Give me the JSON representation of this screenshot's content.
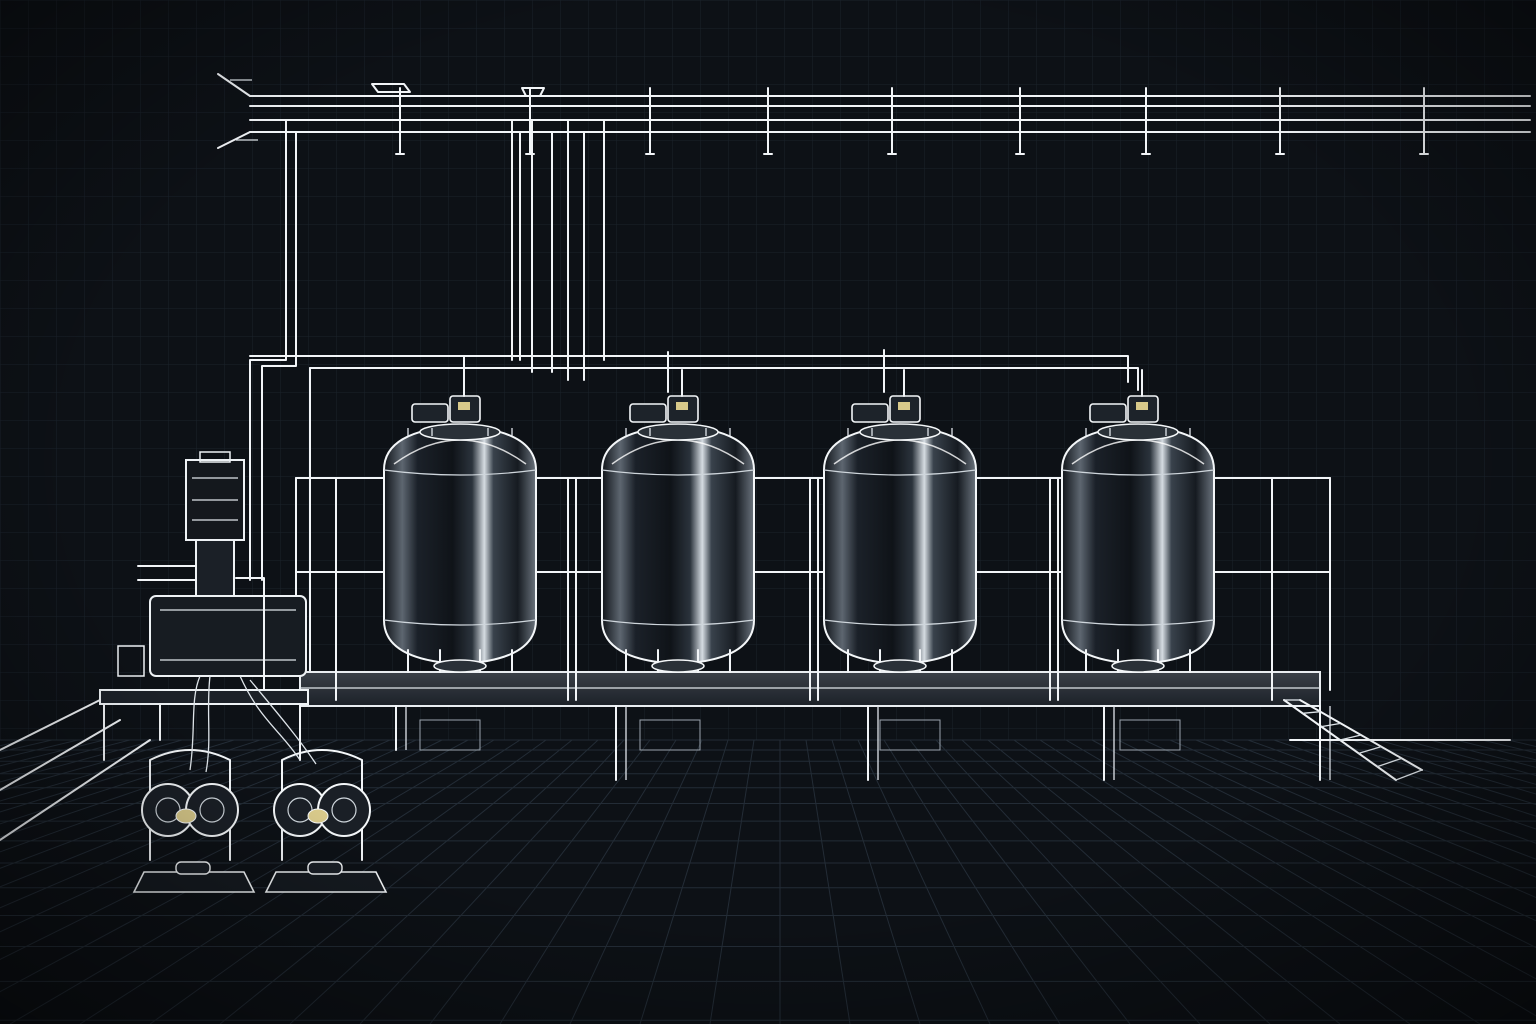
{
  "scene": {
    "subject": "",
    "vessel_count": 4,
    "pump_count": 2
  },
  "palette": {
    "background": "#0d1116",
    "grid": "#1b232c",
    "linework": "#f2f5f8",
    "vessel_fill_dark": "#1a1f26",
    "vessel_fill_light": "#c9d1d8",
    "gauge_accent": "#d8c98a"
  },
  "icons": {
    "vessel": "reactor-tank-icon",
    "pump": "diaphragm-pump-icon",
    "mixer": "mixer-station-icon",
    "stair": "stair-icon",
    "pipe_rack": "pipe-rack-icon"
  }
}
